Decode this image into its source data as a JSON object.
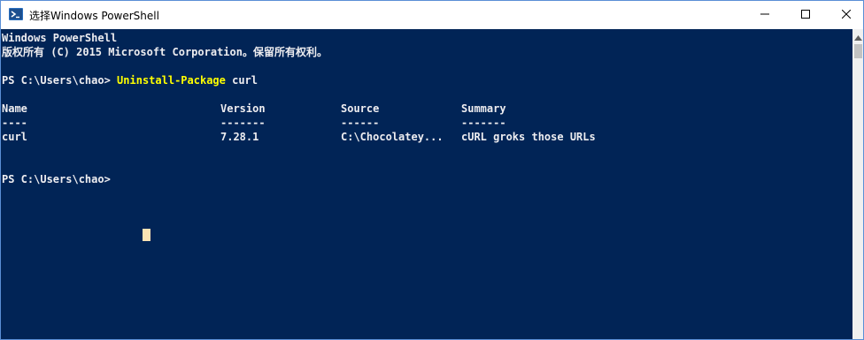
{
  "window": {
    "title": "选择Windows PowerShell",
    "icon": "powershell-icon",
    "controls": {
      "minimize": "minimize-icon",
      "maximize": "maximize-icon",
      "close": "close-icon"
    }
  },
  "console": {
    "background": "#012456",
    "text_color": "#eeedf0",
    "command_color": "#ffff00",
    "banner_line1": "Windows PowerShell",
    "banner_line2": "版权所有 (C) 2015 Microsoft Corporation。保留所有权利。",
    "prompt1": "PS C:\\Users\\chao> ",
    "command1": "Uninstall-Package",
    "command1_arg": " curl",
    "table": {
      "headers": [
        "Name",
        "Version",
        "Source",
        "Summary"
      ],
      "separators": [
        "----",
        "-------",
        "------",
        "-------"
      ],
      "rows": [
        [
          "curl",
          "7.28.1",
          "C:\\Chocolatey...",
          "cURL groks those URLs"
        ]
      ]
    },
    "prompt2": "PS C:\\Users\\chao>"
  }
}
